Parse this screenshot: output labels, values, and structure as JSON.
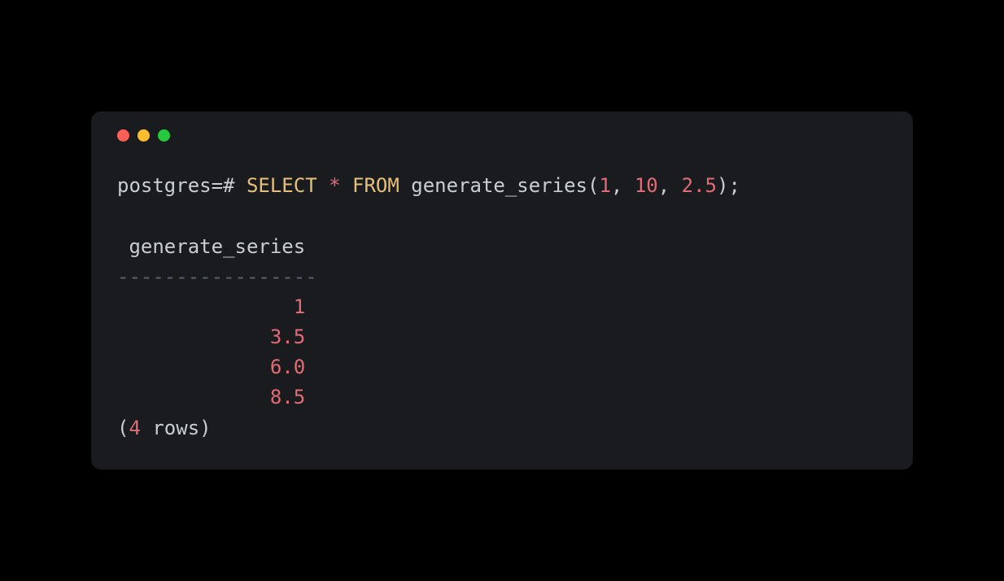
{
  "prompt": "postgres=#",
  "query": {
    "select": "SELECT",
    "star": "*",
    "from": "FROM",
    "func": "generate_series",
    "args": [
      "1",
      "10",
      "2.5"
    ]
  },
  "result": {
    "column_header": " generate_series ",
    "divider": "-----------------",
    "rows": [
      "               1",
      "             3.5",
      "             6.0",
      "             8.5"
    ],
    "footer_open": "(",
    "footer_count": "4",
    "footer_rest": " rows)"
  }
}
